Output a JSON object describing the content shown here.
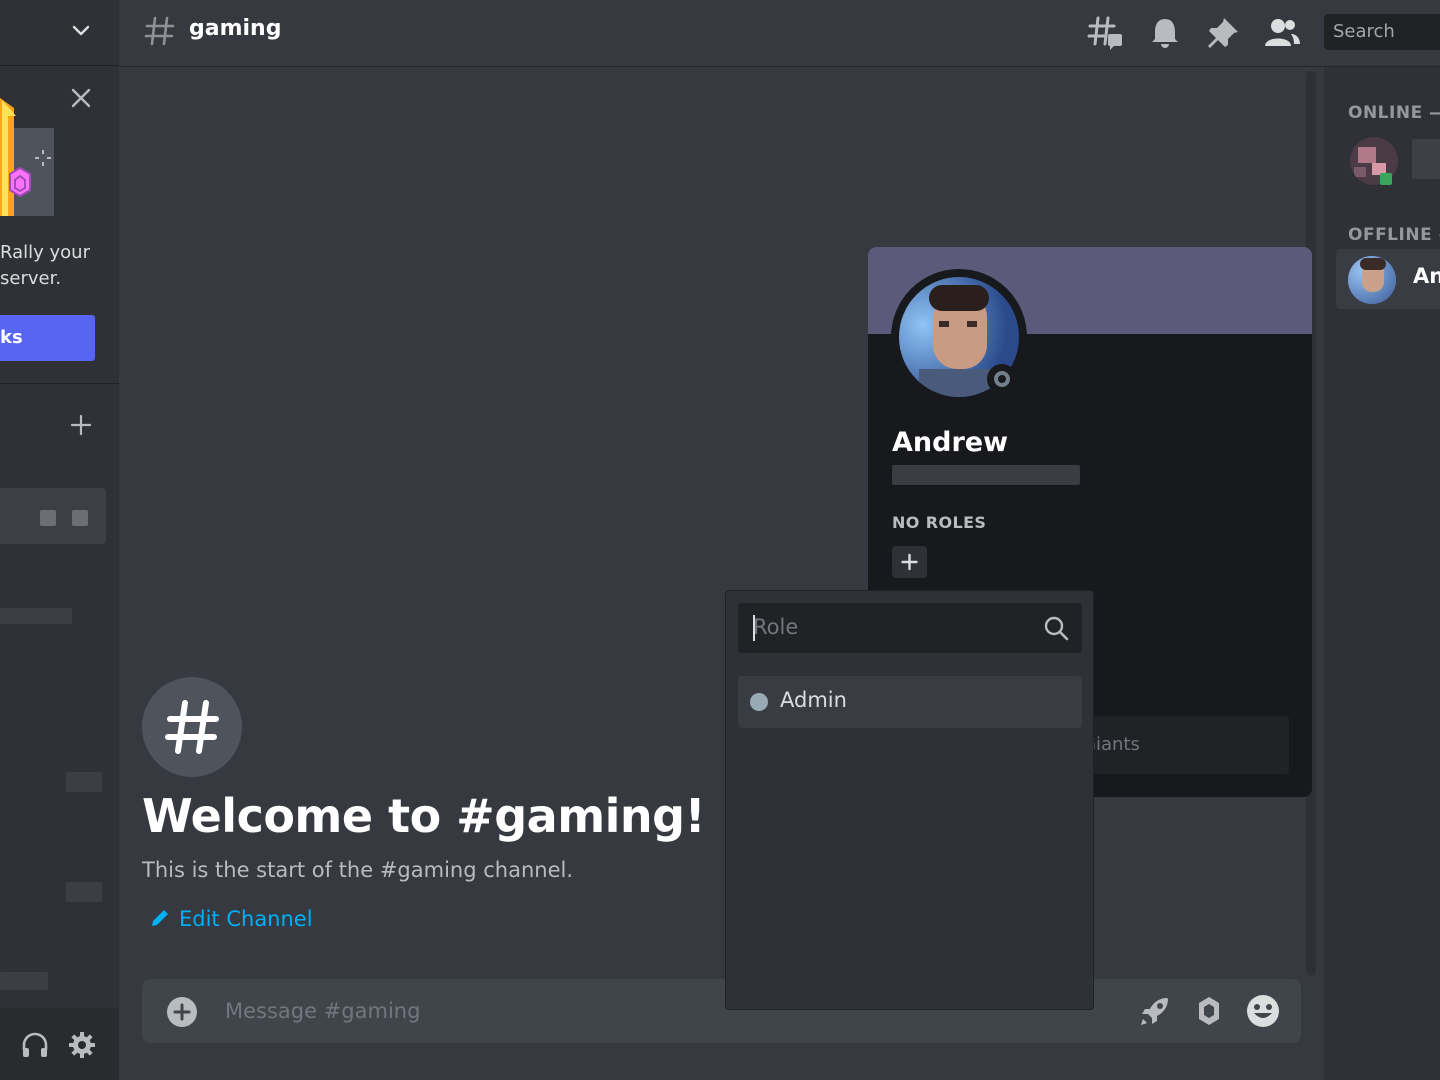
{
  "sidebar": {
    "promo_text": "Rally your\n server.",
    "promo_button": "ks",
    "icons": [
      "chevron-down-icon",
      "close-icon",
      "plus-icon",
      "headphones-icon",
      "gear-icon"
    ]
  },
  "topbar": {
    "channel_name": "gaming",
    "search_placeholder": "Search",
    "icons": [
      "threads-icon",
      "bell-icon",
      "pin-icon",
      "members-icon"
    ]
  },
  "chat": {
    "welcome_title": "Welcome to #gaming!",
    "welcome_sub": "This is the start of the #gaming channel.",
    "edit_channel": "Edit Channel",
    "composer_placeholder": "Message #gaming",
    "composer_icons": [
      "plus-circle-icon",
      "boost-icon",
      "nitro-icon",
      "emoji-icon"
    ]
  },
  "members": {
    "online_header": "ONLINE —",
    "offline_header": "OFFLINE —",
    "offline_member": "An"
  },
  "profile": {
    "name": "Andrew",
    "roles_header": "NO ROLES",
    "note_text": "Giants",
    "accent_color": "#5c5a7a"
  },
  "role_picker": {
    "search_placeholder": "Role",
    "roles": [
      {
        "label": "Admin",
        "color": "#99aab5"
      }
    ]
  },
  "colors": {
    "brand": "#5865f2",
    "link": "#00aff4",
    "background": "#36393f",
    "sidebar": "#2f3136"
  }
}
